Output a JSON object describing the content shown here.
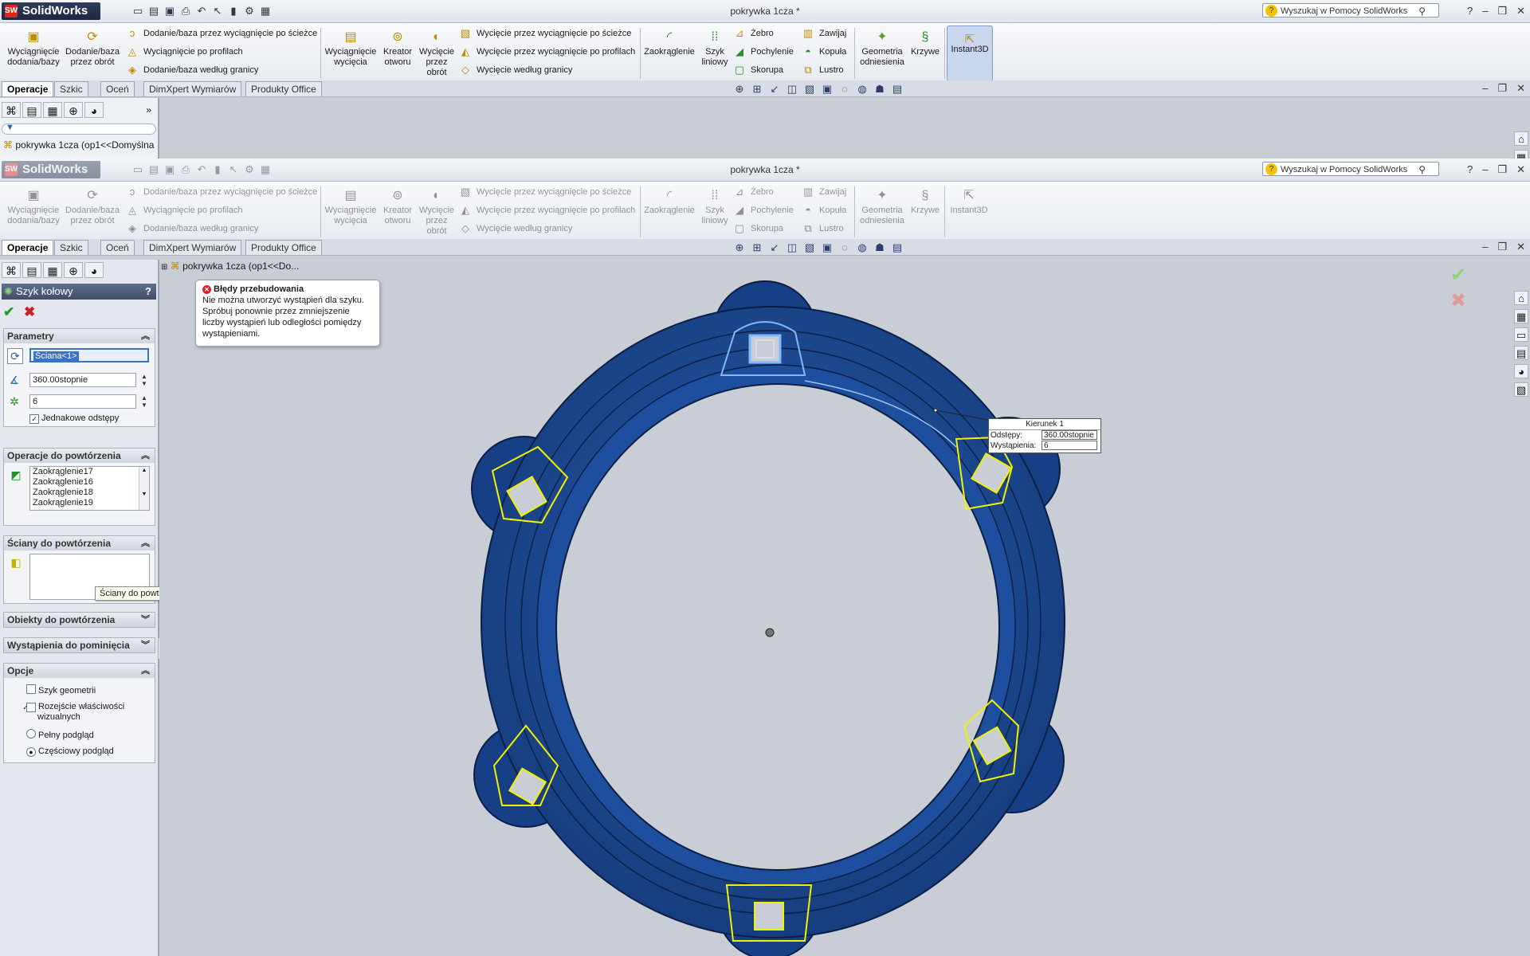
{
  "app": {
    "brand": "SolidWorks",
    "title": "pokrywka 1cza *"
  },
  "search": {
    "placeholder": "Wyszukaj w Pomocy SolidWorks"
  },
  "toolbar": {
    "extrude_boss": "Wyciągnięcie dodania/bazy",
    "revolve_boss": "Dodanie/baza przez obrót",
    "sweep_boss": "Dodanie/baza przez wyciągnięcie po ścieżce",
    "loft_boss": "Wyciągnięcie po profilach",
    "boundary_boss": "Dodanie/baza według granicy",
    "extrude_cut": "Wyciągnięcie wycięcia",
    "hole_wizard": "Kreator otworu",
    "revolve_cut": "Wycięcie przez obrót",
    "sweep_cut": "Wycięcie przez wyciągnięcie po ścieżce",
    "loft_cut": "Wycięcie przez wyciągnięcie po profilach",
    "boundary_cut": "Wycięcie według granicy",
    "fillet": "Zaokrąglenie",
    "linear_pattern": "Szyk liniowy",
    "rib": "Żebro",
    "draft": "Pochylenie",
    "shell": "Skorupa",
    "wrap": "Zawijaj",
    "dome": "Kopuła",
    "mirror": "Lustro",
    "ref_geometry": "Geometria odniesienia",
    "curves": "Krzywe",
    "instant3d": "Instant3D"
  },
  "tabs": [
    "Operacje",
    "Szkic",
    "Oceń",
    "DimXpert Wymiarów",
    "Produkty Office"
  ],
  "tree": {
    "part_top": "pokrywka 1cza  (op1<<Domyślna",
    "part_bottom": "pokrywka 1cza  (op1<<Do..."
  },
  "property_manager": {
    "title": "Szyk kołowy",
    "help": "?",
    "params_header": "Parametry",
    "axis_value": "Ściana<1>",
    "angle_value": "360.00stopnie",
    "count_value": "6",
    "equal_spacing": "Jednakowe odstępy",
    "features_header": "Operacje do powtórzenia",
    "features": [
      "Zaokrąglenie17",
      "Zaokrąglenie16",
      "Zaokrąglenie18",
      "Zaokrąglenie19"
    ],
    "faces_header": "Ściany do powtórzenia",
    "faces_tooltip": "Ściany do powtórzenia",
    "bodies_header": "Obiekty do powtórzenia",
    "skip_header": "Wystąpienia do pominięcia",
    "options_header": "Opcje",
    "geometry_pattern": "Szyk geometrii",
    "propagate": "Rozejście właściwości wizualnych",
    "full_preview": "Pełny podgląd",
    "partial_preview": "Częściowy podgląd"
  },
  "error": {
    "title": "Błędy przebudowania",
    "message": "Nie można utworzyć wystąpień dla szyku. Spróbuj ponownie przez zmniejszenie liczby wystąpień lub odległości pomiędzy wystąpieniami."
  },
  "callout": {
    "title": "Kierunek 1",
    "spacing_label": "Odstępy:",
    "spacing_value": "360.00stopnie",
    "instances_label": "Wystąpienia:",
    "instances_value": "6"
  },
  "colors": {
    "part": "#1f4f9c",
    "highlight": "#f2f200",
    "background": "#c9ced6"
  }
}
